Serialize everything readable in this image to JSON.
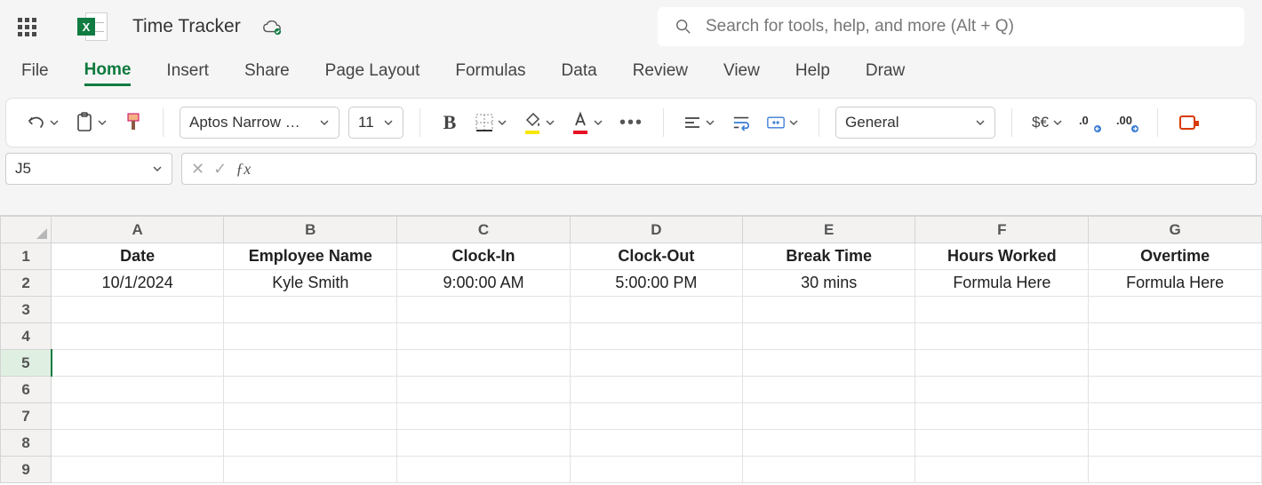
{
  "title": "Time Tracker",
  "search": {
    "placeholder": "Search for tools, help, and more (Alt + Q)"
  },
  "ribbon": {
    "tabs": [
      "File",
      "Home",
      "Insert",
      "Share",
      "Page Layout",
      "Formulas",
      "Data",
      "Review",
      "View",
      "Help",
      "Draw"
    ],
    "active": "Home"
  },
  "toolbar": {
    "font_name": "Aptos Narrow …",
    "font_size": "11",
    "number_format": "General",
    "currency_label": "$€",
    "dec0": ".0",
    "dec00": ".00"
  },
  "name_box": "J5",
  "formula_bar": "",
  "sheet": {
    "columns": [
      "A",
      "B",
      "C",
      "D",
      "E",
      "F",
      "G"
    ],
    "rows": [
      "1",
      "2",
      "3",
      "4",
      "5",
      "6",
      "7",
      "8",
      "9"
    ],
    "selected_row": "5",
    "header_row": [
      "Date",
      "Employee Name",
      "Clock-In",
      "Clock-Out",
      "Break Time",
      "Hours Worked",
      "Overtime"
    ],
    "data_rows": [
      [
        "10/1/2024",
        "Kyle Smith",
        "9:00:00 AM",
        "5:00:00 PM",
        "30 mins",
        "Formula Here",
        "Formula Here"
      ]
    ]
  },
  "excel_badge": "X"
}
